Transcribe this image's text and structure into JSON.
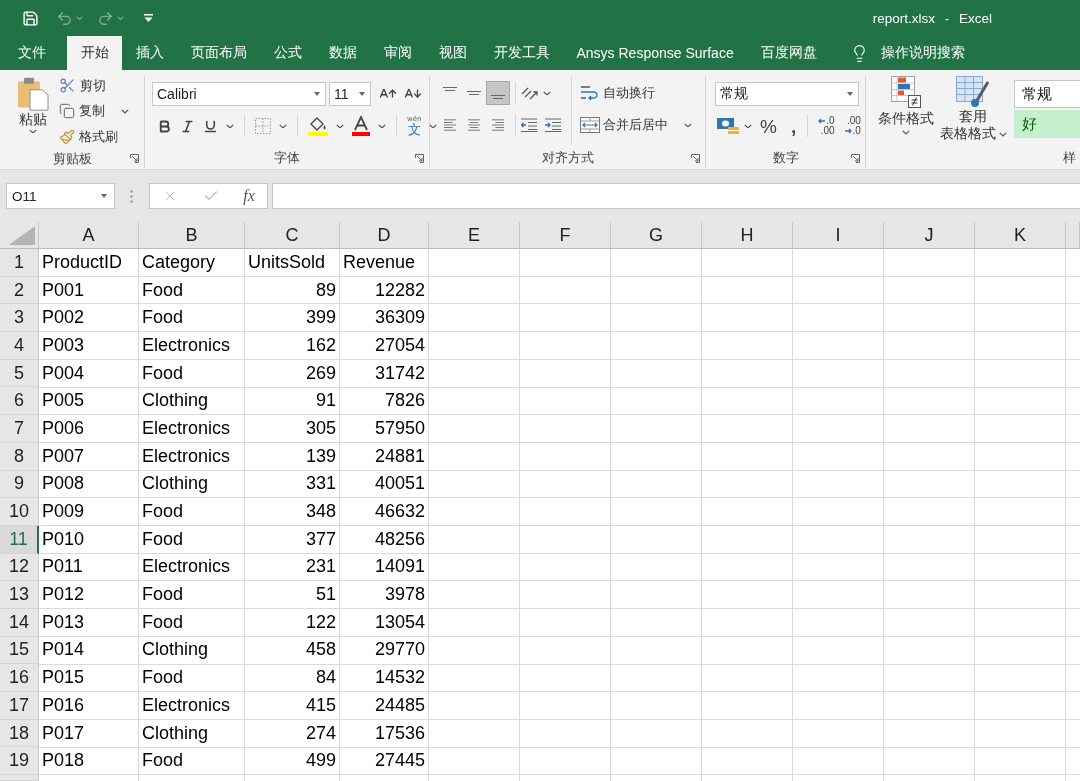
{
  "window": {
    "title": "report.xlsx - Excel"
  },
  "quick_access": [
    {
      "kind": "save",
      "disabled": false
    },
    {
      "kind": "undo",
      "disabled": true
    },
    {
      "kind": "redo",
      "disabled": true
    },
    {
      "kind": "customize",
      "disabled": false
    }
  ],
  "tabs": [
    {
      "label": "文件",
      "selected": false
    },
    {
      "label": "开始",
      "selected": true
    },
    {
      "label": "插入",
      "selected": false
    },
    {
      "label": "页面布局",
      "selected": false
    },
    {
      "label": "公式",
      "selected": false
    },
    {
      "label": "数据",
      "selected": false
    },
    {
      "label": "审阅",
      "selected": false
    },
    {
      "label": "视图",
      "selected": false
    },
    {
      "label": "开发工具",
      "selected": false
    },
    {
      "label": "Ansys Response Surface",
      "selected": false
    },
    {
      "label": "百度网盘",
      "selected": false
    }
  ],
  "tell_me": {
    "label": "操作说明搜索"
  },
  "ribbon": {
    "clipboard": {
      "label": "剪贴板",
      "paste": "粘贴",
      "commands": [
        {
          "kind": "cut",
          "label": "剪切"
        },
        {
          "kind": "copy",
          "label": "复制"
        },
        {
          "kind": "format_painter",
          "label": "格式刷"
        }
      ]
    },
    "font": {
      "label": "字体",
      "font_name": "Calibri",
      "font_size": "11",
      "phonetic": [
        "wén",
        "文"
      ]
    },
    "alignment": {
      "label": "对齐方式",
      "vertical": [
        {
          "kind": "top",
          "selected": false
        },
        {
          "kind": "middle",
          "selected": false
        },
        {
          "kind": "bottom",
          "selected": true
        }
      ],
      "horizontal": [
        {
          "kind": "left",
          "selected": false
        },
        {
          "kind": "center",
          "selected": false
        },
        {
          "kind": "right",
          "selected": false
        }
      ],
      "wrap_text": "自动换行",
      "merge_center": "合并后居中"
    },
    "number": {
      "label": "数字",
      "format": "常规",
      "percent": "%",
      "comma": ",",
      "decimals": [
        {
          "kind": "increase",
          "lines": [
            ".0",
            ".00"
          ]
        },
        {
          "kind": "decrease",
          "lines": [
            ".00",
            ".0"
          ]
        }
      ]
    },
    "styles": {
      "label": "样",
      "conditional_format": "条件格式",
      "table_format": [
        "套用",
        "表格格式"
      ],
      "cell_styles": [
        {
          "kind": "normal",
          "label": "常规"
        },
        {
          "kind": "good",
          "label": "好"
        }
      ]
    }
  },
  "formula_bar": {
    "name_box": "O11",
    "function_button": "fx"
  },
  "sheet": {
    "columns": [
      {
        "letter": "A"
      },
      {
        "letter": "B"
      },
      {
        "letter": "C",
        "numeric": true
      },
      {
        "letter": "D",
        "numeric": true
      },
      {
        "letter": "E"
      },
      {
        "letter": "F"
      },
      {
        "letter": "G"
      },
      {
        "letter": "H"
      },
      {
        "letter": "I"
      },
      {
        "letter": "J"
      },
      {
        "letter": "K"
      }
    ],
    "rows": [
      {
        "header": "1",
        "selected": false,
        "kind": "labels",
        "cells": [
          "ProductID",
          "Category",
          "UnitsSold",
          "Revenue"
        ]
      },
      {
        "header": "2",
        "selected": false,
        "kind": "data",
        "cells": [
          "P001",
          "Food",
          "89",
          "12282"
        ]
      },
      {
        "header": "3",
        "selected": false,
        "kind": "data",
        "cells": [
          "P002",
          "Food",
          "399",
          "36309"
        ]
      },
      {
        "header": "4",
        "selected": false,
        "kind": "data",
        "cells": [
          "P003",
          "Electronics",
          "162",
          "27054"
        ]
      },
      {
        "header": "5",
        "selected": false,
        "kind": "data",
        "cells": [
          "P004",
          "Food",
          "269",
          "31742"
        ]
      },
      {
        "header": "6",
        "selected": false,
        "kind": "data",
        "cells": [
          "P005",
          "Clothing",
          "91",
          "7826"
        ]
      },
      {
        "header": "7",
        "selected": false,
        "kind": "data",
        "cells": [
          "P006",
          "Electronics",
          "305",
          "57950"
        ]
      },
      {
        "header": "8",
        "selected": false,
        "kind": "data",
        "cells": [
          "P007",
          "Electronics",
          "139",
          "24881"
        ]
      },
      {
        "header": "9",
        "selected": false,
        "kind": "data",
        "cells": [
          "P008",
          "Clothing",
          "331",
          "40051"
        ]
      },
      {
        "header": "10",
        "selected": false,
        "kind": "data",
        "cells": [
          "P009",
          "Food",
          "348",
          "46632"
        ]
      },
      {
        "header": "11",
        "selected": true,
        "kind": "data",
        "cells": [
          "P010",
          "Food",
          "377",
          "48256"
        ]
      },
      {
        "header": "12",
        "selected": false,
        "kind": "data",
        "cells": [
          "P011",
          "Electronics",
          "231",
          "14091"
        ]
      },
      {
        "header": "13",
        "selected": false,
        "kind": "data",
        "cells": [
          "P012",
          "Food",
          "51",
          "3978"
        ]
      },
      {
        "header": "14",
        "selected": false,
        "kind": "data",
        "cells": [
          "P013",
          "Food",
          "122",
          "13054"
        ]
      },
      {
        "header": "15",
        "selected": false,
        "kind": "data",
        "cells": [
          "P014",
          "Clothing",
          "458",
          "29770"
        ]
      },
      {
        "header": "16",
        "selected": false,
        "kind": "data",
        "cells": [
          "P015",
          "Food",
          "84",
          "14532"
        ]
      },
      {
        "header": "17",
        "selected": false,
        "kind": "data",
        "cells": [
          "P016",
          "Electronics",
          "415",
          "24485"
        ]
      },
      {
        "header": "18",
        "selected": false,
        "kind": "data",
        "cells": [
          "P017",
          "Clothing",
          "274",
          "17536"
        ]
      },
      {
        "header": "19",
        "selected": false,
        "kind": "data",
        "cells": [
          "P018",
          "Food",
          "499",
          "27445"
        ]
      }
    ]
  }
}
